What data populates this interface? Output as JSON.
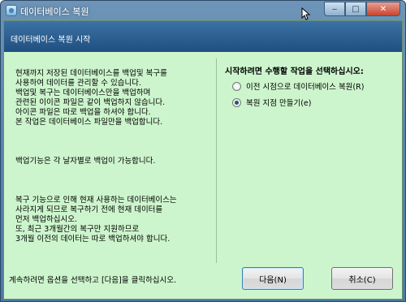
{
  "window": {
    "title": "데이터베이스 복원",
    "controls": {
      "minimize": "‒",
      "maximize": "□",
      "close": "✕"
    }
  },
  "banner": {
    "title": "데이터베이스 복원 시작"
  },
  "description": {
    "paragraph1": "현재까지 저장된 데이터베이스를 백업및 복구를\n사용하여 데이터를 관리할 수 있습니다.\n백업및 복구는 데이터베이스만을 백업하며\n관련된 이이콘 파일은 같이 백업하지 않습니다.\n아이콘 파일은 따로 백업을 하셔야 합니다.\n본 작업은 데이터베이스 파일만을 백업합니다.",
    "paragraph2": "백업기능은 각 날자별로 백업이 가능합니다.",
    "paragraph3": "복구 기능으로 인해 현재 사용하는 데이터베이스는\n사라지게 되므로 복구하기 전에 현재 데이터를\n먼저 백업하십시오.\n또, 최근 3개월간의 복구만 지원하므로\n3개월 이전의 데이터는 따로 백업하셔야 합니다."
  },
  "options": {
    "prompt": "시작하려면 수행할 작업을 선택하십시오:",
    "items": [
      {
        "label": "이전 시점으로 데이터베이스 복원(R)",
        "checked": false
      },
      {
        "label": "복원 지점 만들기(e)",
        "checked": true
      }
    ]
  },
  "footer": {
    "hint": "계속하려면 옵션을 선택하고 [다음]을 클릭하십시오.",
    "next_label": "다음(N)",
    "cancel_label": "취소(C)"
  }
}
